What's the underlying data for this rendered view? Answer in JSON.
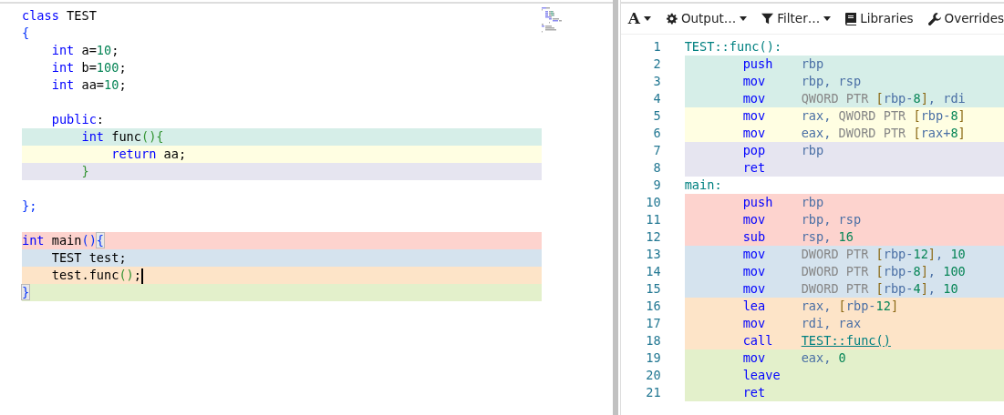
{
  "source_editor": {
    "lines": [
      {
        "segments": [
          {
            "text": "class",
            "kind": "kw"
          },
          {
            "text": "TEST",
            "kind": "text"
          }
        ]
      },
      {
        "segments": [
          {
            "text": "{",
            "kind": "brace"
          }
        ]
      },
      {
        "segments": [
          {
            "text": "    int",
            "kind": "kw"
          },
          {
            "text": " a=",
            "kind": "text"
          },
          {
            "text": "10",
            "kind": "num"
          },
          {
            "text": ";",
            "kind": "text"
          }
        ]
      },
      {
        "segments": [
          {
            "text": "    int",
            "kind": "kw"
          },
          {
            "text": " b=",
            "kind": "text"
          },
          {
            "text": "100",
            "kind": "num"
          },
          {
            "text": ";",
            "kind": "text"
          }
        ]
      },
      {
        "segments": [
          {
            "text": "    int",
            "kind": "kw"
          },
          {
            "text": " aa=",
            "kind": "text"
          },
          {
            "text": "10",
            "kind": "num"
          },
          {
            "text": ";",
            "kind": "text"
          }
        ]
      },
      {
        "segments": [
          {
            "text": "    public",
            "kind": "kw"
          },
          {
            "text": ":",
            "kind": "text"
          }
        ],
        "gap_before": true
      },
      {
        "segments": [
          {
            "text": "        int",
            "kind": "kw"
          },
          {
            "text": " func",
            "kind": "text"
          },
          {
            "text": "(){",
            "kind": "punct"
          }
        ],
        "color": "#d6eee8"
      },
      {
        "segments": [
          {
            "text": "            return",
            "kind": "kw"
          },
          {
            "text": " aa;",
            "kind": "text"
          }
        ],
        "color": "#fffee2"
      },
      {
        "segments": [
          {
            "text": "        }",
            "kind": "punct"
          }
        ],
        "color": "#e6e5f0"
      },
      {
        "segments": [
          {
            "text": "};",
            "kind": "brace"
          }
        ],
        "gap_before": true
      },
      {
        "segments": [
          {
            "text": "int",
            "kind": "kw"
          },
          {
            "text": " main",
            "kind": "text"
          },
          {
            "text": "()",
            "kind": "brace"
          },
          {
            "text": "{",
            "kind": "match"
          }
        ],
        "color": "#fdd3ce",
        "gap_before": true
      },
      {
        "segments": [
          {
            "text": "    TEST test;",
            "kind": "text"
          }
        ],
        "color": "#d5e3ee"
      },
      {
        "segments": [
          {
            "text": "    test.func",
            "kind": "text"
          },
          {
            "text": "()",
            "kind": "punct"
          },
          {
            "text": ";",
            "kind": "text"
          }
        ],
        "color": "#fde4c8",
        "cursor": true
      },
      {
        "segments": [
          {
            "text": "}",
            "kind": "match"
          }
        ],
        "color": "#e3f0cb"
      }
    ]
  },
  "toolbar": [
    {
      "kind": "font",
      "label": "A",
      "dropdown": true
    },
    {
      "kind": "gear",
      "label": "Output…",
      "dropdown": true
    },
    {
      "kind": "filter",
      "label": "Filter…",
      "dropdown": true
    },
    {
      "kind": "book",
      "label": "Libraries"
    },
    {
      "kind": "wrench",
      "label": "Overrides"
    }
  ],
  "assembly": {
    "lines": [
      {
        "number": "1",
        "label": "TEST::func():"
      },
      {
        "number": "2",
        "op": "push",
        "args": [
          {
            "text": "rbp",
            "kind": "reg"
          }
        ],
        "color": "#d6eee8"
      },
      {
        "number": "3",
        "op": "mov",
        "args": [
          {
            "text": "rbp, rsp",
            "kind": "reg"
          }
        ],
        "color": "#d6eee8"
      },
      {
        "number": "4",
        "op": "mov",
        "args": [
          {
            "text": "QWORD PTR",
            "kind": "size"
          },
          {
            "text": " [",
            "kind": "br"
          },
          {
            "text": "rbp-",
            "kind": "reg"
          },
          {
            "text": "8",
            "kind": "num"
          },
          {
            "text": "]",
            "kind": "br"
          },
          {
            "text": ", rdi",
            "kind": "reg"
          }
        ],
        "color": "#d6eee8"
      },
      {
        "number": "5",
        "op": "mov",
        "args": [
          {
            "text": "rax,",
            "kind": "reg"
          },
          {
            "text": " QWORD PTR",
            "kind": "size"
          },
          {
            "text": " [",
            "kind": "br"
          },
          {
            "text": "rbp-",
            "kind": "reg"
          },
          {
            "text": "8",
            "kind": "num"
          },
          {
            "text": "]",
            "kind": "br"
          }
        ],
        "color": "#fffee2"
      },
      {
        "number": "6",
        "op": "mov",
        "args": [
          {
            "text": "eax,",
            "kind": "reg"
          },
          {
            "text": " DWORD PTR",
            "kind": "size"
          },
          {
            "text": " [",
            "kind": "br"
          },
          {
            "text": "rax+",
            "kind": "reg"
          },
          {
            "text": "8",
            "kind": "num"
          },
          {
            "text": "]",
            "kind": "br"
          }
        ],
        "color": "#fffee2"
      },
      {
        "number": "7",
        "op": "pop",
        "args": [
          {
            "text": "rbp",
            "kind": "reg"
          }
        ],
        "color": "#e6e5f0"
      },
      {
        "number": "8",
        "op": "ret",
        "color": "#e6e5f0"
      },
      {
        "number": "9",
        "label": "main:"
      },
      {
        "number": "10",
        "op": "push",
        "args": [
          {
            "text": "rbp",
            "kind": "reg"
          }
        ],
        "color": "#fdd3ce"
      },
      {
        "number": "11",
        "op": "mov",
        "args": [
          {
            "text": "rbp, rsp",
            "kind": "reg"
          }
        ],
        "color": "#fdd3ce"
      },
      {
        "number": "12",
        "op": "sub",
        "args": [
          {
            "text": "rsp,",
            "kind": "reg"
          },
          {
            "text": " 16",
            "kind": "num"
          }
        ],
        "color": "#fdd3ce"
      },
      {
        "number": "13",
        "op": "mov",
        "args": [
          {
            "text": "DWORD PTR",
            "kind": "size"
          },
          {
            "text": " [",
            "kind": "br"
          },
          {
            "text": "rbp-",
            "kind": "reg"
          },
          {
            "text": "12",
            "kind": "num"
          },
          {
            "text": "]",
            "kind": "br"
          },
          {
            "text": ",",
            "kind": "reg"
          },
          {
            "text": " 10",
            "kind": "num"
          }
        ],
        "color": "#d5e3ee"
      },
      {
        "number": "14",
        "op": "mov",
        "args": [
          {
            "text": "DWORD PTR",
            "kind": "size"
          },
          {
            "text": " [",
            "kind": "br"
          },
          {
            "text": "rbp-",
            "kind": "reg"
          },
          {
            "text": "8",
            "kind": "num"
          },
          {
            "text": "]",
            "kind": "br"
          },
          {
            "text": ",",
            "kind": "reg"
          },
          {
            "text": " 100",
            "kind": "num"
          }
        ],
        "color": "#d5e3ee"
      },
      {
        "number": "15",
        "op": "mov",
        "args": [
          {
            "text": "DWORD PTR",
            "kind": "size"
          },
          {
            "text": " [",
            "kind": "br"
          },
          {
            "text": "rbp-",
            "kind": "reg"
          },
          {
            "text": "4",
            "kind": "num"
          },
          {
            "text": "]",
            "kind": "br"
          },
          {
            "text": ",",
            "kind": "reg"
          },
          {
            "text": " 10",
            "kind": "num"
          }
        ],
        "color": "#d5e3ee"
      },
      {
        "number": "16",
        "op": "lea",
        "args": [
          {
            "text": "rax,",
            "kind": "reg"
          },
          {
            "text": " [",
            "kind": "br"
          },
          {
            "text": "rbp-",
            "kind": "reg"
          },
          {
            "text": "12",
            "kind": "num"
          },
          {
            "text": "]",
            "kind": "br"
          }
        ],
        "color": "#fde4c8"
      },
      {
        "number": "17",
        "op": "mov",
        "args": [
          {
            "text": "rdi, rax",
            "kind": "reg"
          }
        ],
        "color": "#fde4c8"
      },
      {
        "number": "18",
        "op": "call",
        "args": [
          {
            "text": "TEST::func()",
            "kind": "link"
          }
        ],
        "color": "#fde4c8"
      },
      {
        "number": "19",
        "op": "mov",
        "args": [
          {
            "text": "eax,",
            "kind": "reg"
          },
          {
            "text": " 0",
            "kind": "num"
          }
        ],
        "color": "#e3f0cb"
      },
      {
        "number": "20",
        "op": "leave",
        "color": "#e3f0cb"
      },
      {
        "number": "21",
        "op": "ret",
        "color": "#e3f0cb"
      }
    ]
  }
}
